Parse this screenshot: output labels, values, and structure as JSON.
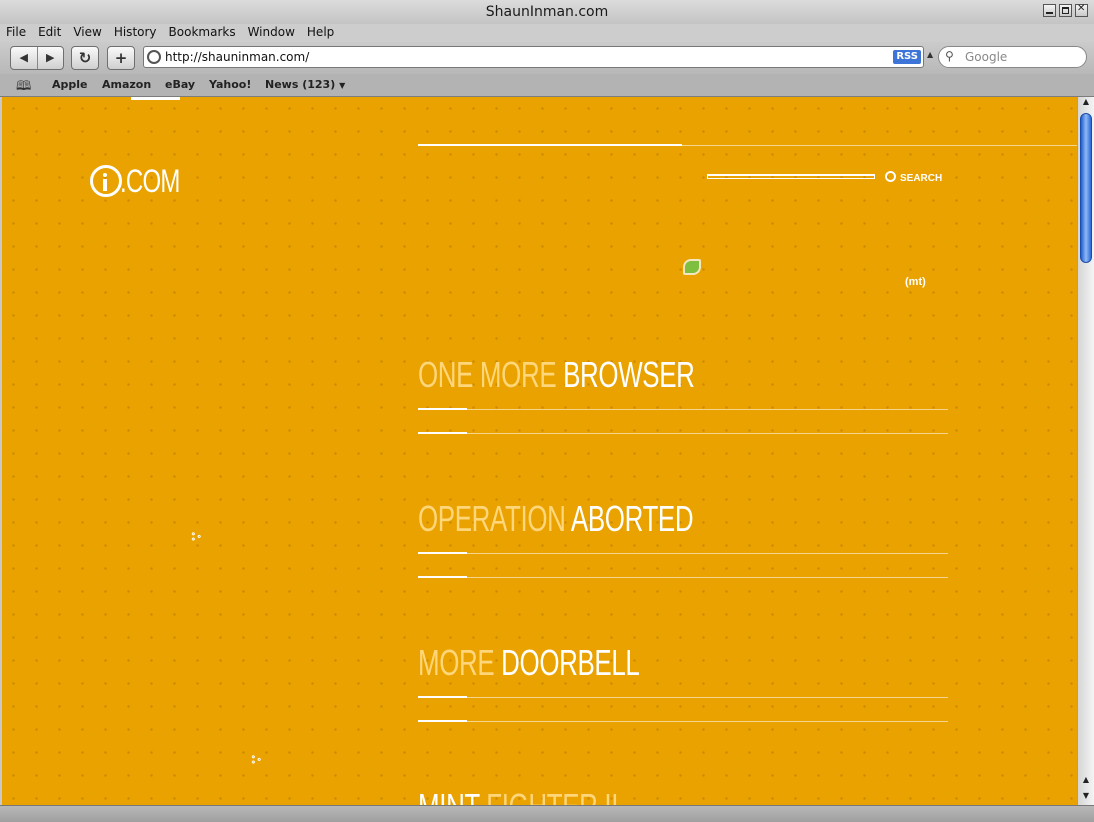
{
  "window": {
    "title": "ShaunInman.com"
  },
  "menu": [
    "File",
    "Edit",
    "View",
    "History",
    "Bookmarks",
    "Window",
    "Help"
  ],
  "toolbar": {
    "back_icon": "◀",
    "forward_icon": "▶",
    "reload_icon": "↻",
    "add_icon": "+",
    "url": "http://shauninman.com/",
    "rss_label": "RSS",
    "search_placeholder": "Google"
  },
  "bookmarks": [
    "Apple",
    "Amazon",
    "eBay",
    "Yahoo!",
    "News (123)"
  ],
  "page": {
    "logo_text": ".COM",
    "search_label": "SEARCH",
    "mint_text": "(mt)",
    "posts": [
      {
        "dim": "ONE MORE",
        "bright": "BROWSER"
      },
      {
        "dim": "OPERATION",
        "bright": "ABORTED"
      },
      {
        "dim": "MORE",
        "bright": "DOORBELL"
      },
      {
        "dim": "FIGHTER II",
        "bright": "MINT"
      }
    ],
    "side_glyph": "ஃ"
  },
  "colors": {
    "page_bg": "#e9a200",
    "dim_title": "#ffd67a",
    "accent": "#ffffff"
  }
}
